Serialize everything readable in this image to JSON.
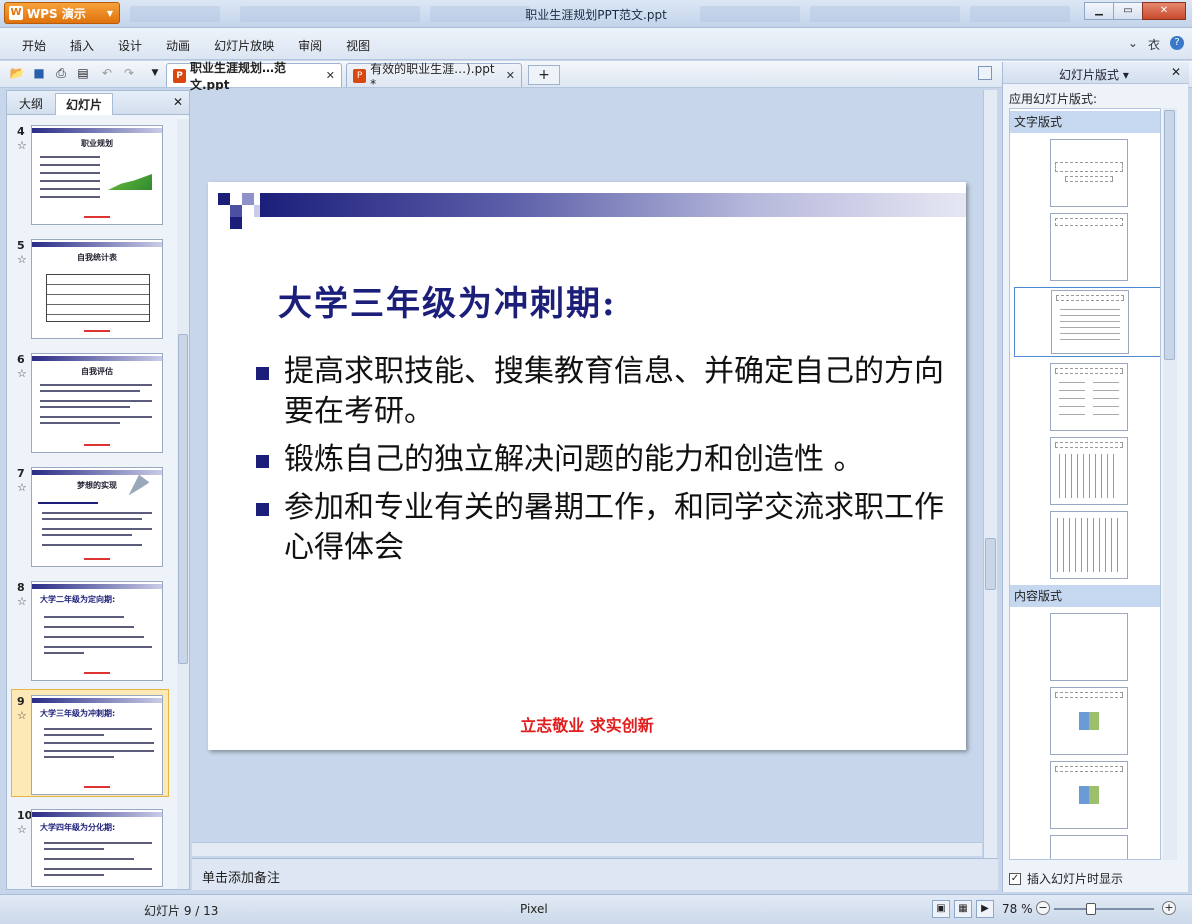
{
  "app": {
    "name": "WPS 演示",
    "window_title": "职业生涯规划PPT范文.ppt"
  },
  "menu": [
    "开始",
    "插入",
    "设计",
    "动画",
    "幻灯片放映",
    "审阅",
    "视图"
  ],
  "menu_right": {
    "collapse": "⌄",
    "skin": "衣",
    "help": "?"
  },
  "tabs": [
    {
      "label": "职业生涯规划…范文.ppt",
      "close": "✕",
      "active": true
    },
    {
      "label": "有效的职业生涯…).ppt *",
      "close": "✕",
      "active": false
    }
  ],
  "tab_plus": "+",
  "left_panel": {
    "tabs": [
      "大纲",
      "幻灯片"
    ],
    "close": "✕",
    "thumbnails": [
      {
        "num": "4",
        "star": "☆",
        "title": "职业规划"
      },
      {
        "num": "5",
        "star": "☆",
        "title": "自我统计表"
      },
      {
        "num": "6",
        "star": "☆",
        "title": "自我评估"
      },
      {
        "num": "7",
        "star": "☆",
        "title": "梦想的实现"
      },
      {
        "num": "8",
        "star": "☆",
        "title": "大学二年级为定向期:"
      },
      {
        "num": "9",
        "star": "☆",
        "title": "大学三年级为冲刺期:"
      },
      {
        "num": "10",
        "star": "☆",
        "title": "大学四年级为分化期:"
      }
    ]
  },
  "slide": {
    "title": "大学三年级为冲刺期:",
    "bullets": [
      "提高求职技能、搜集教育信息、并确定自己的方向要在考研。",
      "锻炼自己的独立解决问题的能力和创造性 。",
      "参加和专业有关的暑期工作，和同学交流求职工作心得体会"
    ],
    "footer": "立志敬业  求实创新"
  },
  "notes_placeholder": "单击添加备注",
  "right_panel": {
    "title": "幻灯片版式 ▾",
    "close": "✕",
    "apply_label": "应用幻灯片版式:",
    "section1": "文字版式",
    "section2": "内容版式",
    "checkbox_label": "插入幻灯片时显示"
  },
  "status": {
    "slide": "幻灯片 9 / 13",
    "theme": "Pixel",
    "zoom": "78 %"
  },
  "colors": {
    "accent": "#1c1f7a",
    "slogan": "#e11d1d",
    "appbtn": "#f08a1c"
  }
}
